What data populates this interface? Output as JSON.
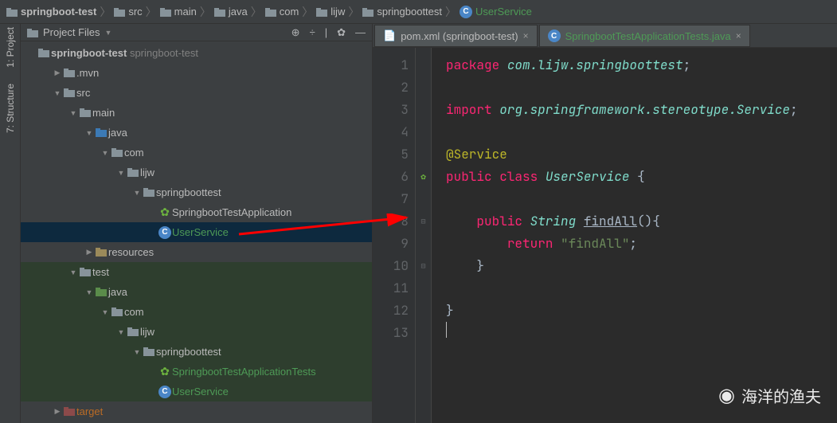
{
  "breadcrumb": [
    {
      "label": "springboot-test",
      "bold": true,
      "type": "module"
    },
    {
      "label": "src",
      "type": "folder"
    },
    {
      "label": "main",
      "type": "folder"
    },
    {
      "label": "java",
      "type": "folder"
    },
    {
      "label": "com",
      "type": "folder"
    },
    {
      "label": "lijw",
      "type": "folder"
    },
    {
      "label": "springboottest",
      "type": "folder"
    },
    {
      "label": "UserService",
      "type": "class",
      "current": true
    }
  ],
  "sidebar_tabs": {
    "project": "1: Project",
    "structure": "7: Structure"
  },
  "panel": {
    "title": "Project Files",
    "actions": {
      "target": "⊕",
      "collapse": "÷",
      "separator": "|",
      "gear": "✿",
      "minimize": "—"
    }
  },
  "tree": {
    "root": {
      "label": "springboot-test",
      "path": "springboot-test"
    },
    "mvn": ".mvn",
    "src": "src",
    "main": "main",
    "java1": "java",
    "com1": "com",
    "lijw1": "lijw",
    "sbtest1": "springboottest",
    "app1": "SpringbootTestApplication",
    "userservice1": "UserService",
    "resources": "resources",
    "test": "test",
    "java2": "java",
    "com2": "com",
    "lijw2": "lijw",
    "sbtest2": "springboottest",
    "apptest": "SpringbootTestApplicationTests",
    "userservice2": "UserService",
    "target": "target"
  },
  "editor": {
    "tabs": [
      {
        "label": "pom.xml (springboot-test)",
        "icon": "file"
      },
      {
        "label": "SpringbootTestApplicationTests.java",
        "icon": "class",
        "teal": true
      }
    ],
    "lines": [
      "1",
      "2",
      "3",
      "4",
      "5",
      "6",
      "7",
      "8",
      "9",
      "10",
      "11",
      "12",
      "13"
    ]
  },
  "chart_data": {
    "type": "code",
    "language": "java",
    "filename": "UserService.java",
    "content": "package com.lijw.springboottest;\n\nimport org.springframework.stereotype.Service;\n\n@Service\npublic class UserService {\n\n    public String findAll(){\n        return \"findAll\";\n    }\n\n}\n",
    "tokens": {
      "l1": {
        "kw1": "package ",
        "pkg": "com.lijw.springboottest",
        "semi": ";"
      },
      "l3": {
        "kw1": "import ",
        "pkg": "org.springframework.stereotype.Service",
        "semi": ";"
      },
      "l5": {
        "ann": "@Service"
      },
      "l6": {
        "kw1": "public ",
        "kw2": "class ",
        "name": "UserService",
        "brace": " {"
      },
      "l8": {
        "indent": "    ",
        "kw1": "public ",
        "type": "String",
        "sp": " ",
        "method": "findAll",
        "paren": "(){"
      },
      "l9": {
        "indent": "        ",
        "kw1": "return ",
        "str": "\"findAll\"",
        "semi": ";"
      },
      "l10": {
        "indent": "    ",
        "brace": "}"
      },
      "l12": {
        "brace": "}"
      }
    }
  },
  "watermark": "海洋的渔夫"
}
